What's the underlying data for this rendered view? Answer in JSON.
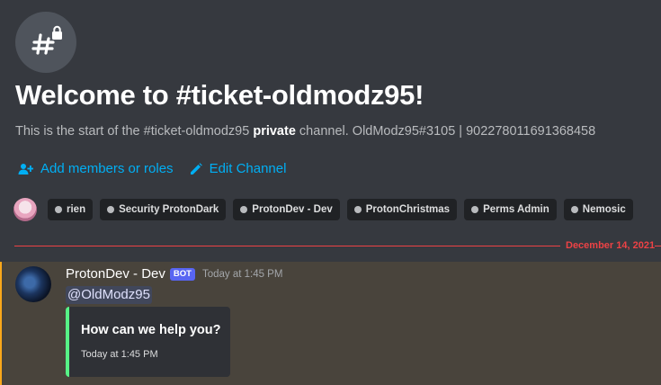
{
  "welcome": {
    "title": "Welcome to #ticket-oldmodz95!",
    "desc_prefix": "This is the start of the #ticket-oldmodz95 ",
    "desc_bold": "private",
    "desc_suffix": " channel. OldModz95#3105 | 902278011691368458"
  },
  "actions": {
    "add_members": "Add members or roles",
    "edit_channel": "Edit Channel"
  },
  "roles": [
    "rien",
    "Security ProtonDark",
    "ProtonDev - Dev",
    "ProtonChristmas",
    "Perms Admin",
    "Nemosic"
  ],
  "divider": {
    "date": "December 14, 2021"
  },
  "message": {
    "author": "ProtonDev - Dev",
    "bot_tag": "BOT",
    "timestamp": "Today at 1:45 PM",
    "mention": "@OldModz95",
    "embed": {
      "title": "How can we help you?",
      "footer": "Today at 1:45 PM",
      "color": "#57f287"
    }
  },
  "colors": {
    "background": "#36393f",
    "link": "#00aff4",
    "divider": "#ed4245",
    "mention_highlight": "#faa81a",
    "bot_tag": "#5865f2"
  },
  "icons": {
    "hero": "hashtag-lock-icon",
    "add_members": "person-add-icon",
    "edit_channel": "pencil-icon"
  }
}
